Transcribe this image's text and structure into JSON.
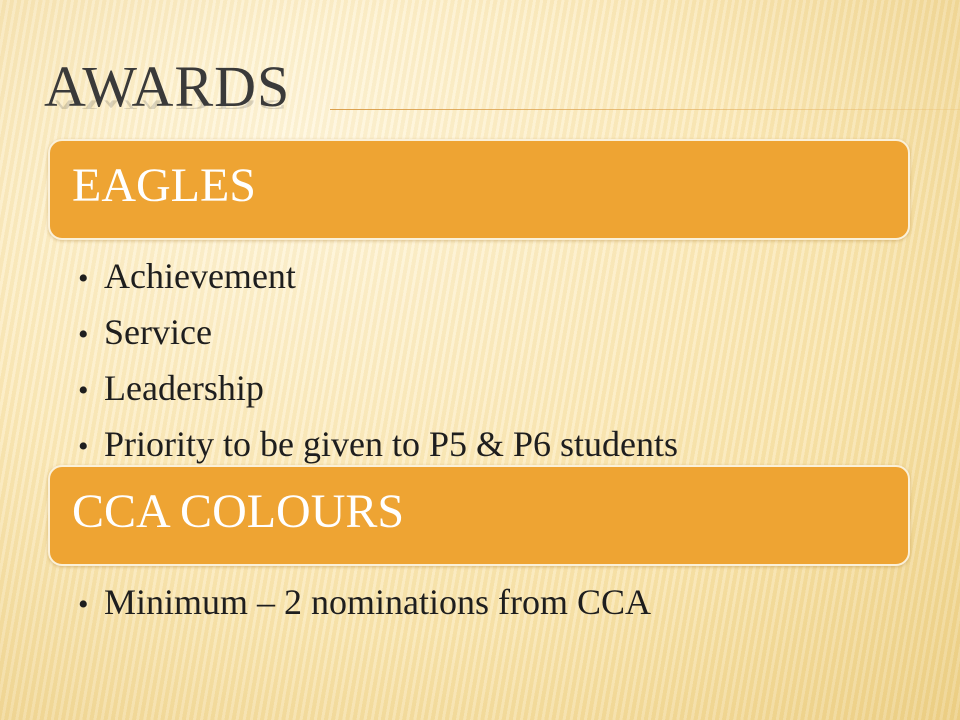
{
  "slide": {
    "title": "AWARDS",
    "sections": [
      {
        "heading": "EAGLES",
        "bullets": [
          "Achievement",
          "Service",
          "Leadership",
          "Priority to be given to P5 & P6 students"
        ]
      },
      {
        "heading": "CCA COLOURS",
        "bullets": [
          "Minimum – 2 nominations from CCA"
        ]
      }
    ]
  },
  "colors": {
    "header_fill": "#eea433",
    "header_text": "#ffffff",
    "title_text": "#3a3a3a",
    "body_text": "#1e1e1e"
  }
}
